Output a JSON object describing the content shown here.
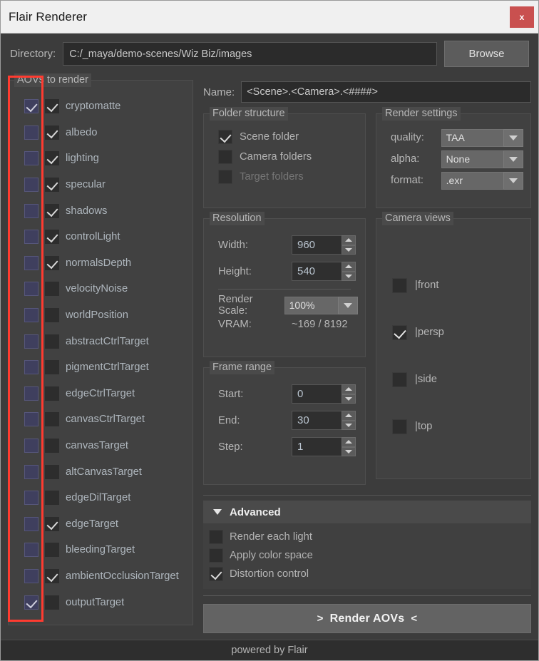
{
  "window": {
    "title": "Flair Renderer",
    "close_label": "x"
  },
  "directory": {
    "label": "Directory:",
    "value": "C:/_maya/demo-scenes/Wiz Biz/images",
    "browse_label": "Browse"
  },
  "aovs": {
    "group_title": "AOVs to render",
    "items": [
      {
        "label": "cryptomatte",
        "col1": true,
        "col2": true
      },
      {
        "label": "albedo",
        "col1": false,
        "col2": true
      },
      {
        "label": "lighting",
        "col1": false,
        "col2": true
      },
      {
        "label": "specular",
        "col1": false,
        "col2": true
      },
      {
        "label": "shadows",
        "col1": false,
        "col2": true
      },
      {
        "label": "controlLight",
        "col1": false,
        "col2": true
      },
      {
        "label": "normalsDepth",
        "col1": false,
        "col2": true
      },
      {
        "label": "velocityNoise",
        "col1": false,
        "col2": false
      },
      {
        "label": "worldPosition",
        "col1": false,
        "col2": false
      },
      {
        "label": "abstractCtrlTarget",
        "col1": false,
        "col2": false
      },
      {
        "label": "pigmentCtrlTarget",
        "col1": false,
        "col2": false
      },
      {
        "label": "edgeCtrlTarget",
        "col1": false,
        "col2": false
      },
      {
        "label": "canvasCtrlTarget",
        "col1": false,
        "col2": false
      },
      {
        "label": "canvasTarget",
        "col1": false,
        "col2": false
      },
      {
        "label": "altCanvasTarget",
        "col1": false,
        "col2": false
      },
      {
        "label": "edgeDilTarget",
        "col1": false,
        "col2": false
      },
      {
        "label": "edgeTarget",
        "col1": false,
        "col2": true
      },
      {
        "label": "bleedingTarget",
        "col1": false,
        "col2": false
      },
      {
        "label": "ambientOcclusionTarget",
        "col1": false,
        "col2": true
      },
      {
        "label": "outputTarget",
        "col1": true,
        "col2": false
      }
    ]
  },
  "name_field": {
    "label": "Name:",
    "value": "<Scene>.<Camera>.<####>"
  },
  "folder_structure": {
    "title": "Folder structure",
    "items": [
      {
        "label": "Scene folder",
        "checked": true,
        "disabled": false
      },
      {
        "label": "Camera folders",
        "checked": false,
        "disabled": false
      },
      {
        "label": "Target folders",
        "checked": false,
        "disabled": true
      }
    ]
  },
  "render_settings": {
    "title": "Render settings",
    "rows": [
      {
        "label": "quality:",
        "value": "TAA"
      },
      {
        "label": "alpha:",
        "value": "None"
      },
      {
        "label": "format:",
        "value": ".exr"
      }
    ]
  },
  "resolution": {
    "title": "Resolution",
    "width_label": "Width:",
    "width_value": "960",
    "height_label": "Height:",
    "height_value": "540",
    "scale_label": "Render Scale:",
    "scale_value": "100%",
    "vram_label": "VRAM:",
    "vram_value": "~169 / 8192"
  },
  "camera_views": {
    "title": "Camera views",
    "items": [
      {
        "label": "|front",
        "checked": false
      },
      {
        "label": "|persp",
        "checked": true
      },
      {
        "label": "|side",
        "checked": false
      },
      {
        "label": "|top",
        "checked": false
      }
    ]
  },
  "frame_range": {
    "title": "Frame range",
    "start_label": "Start:",
    "start_value": "0",
    "end_label": "End:",
    "end_value": "30",
    "step_label": "Step:",
    "step_value": "1"
  },
  "advanced": {
    "title": "Advanced",
    "items": [
      {
        "label": "Render each light",
        "checked": false
      },
      {
        "label": "Apply color space",
        "checked": false
      },
      {
        "label": "Distortion control",
        "checked": true
      }
    ]
  },
  "render_button": {
    "left_arrow": ">",
    "label": "Render AOVs",
    "right_arrow": "<"
  },
  "footer": {
    "text": "powered by Flair"
  },
  "colors": {
    "accent_red": "#ff3b30",
    "close_red": "#c9504f",
    "panel_bg": "#414141",
    "window_bg": "#3c3c3c",
    "violet_checkbox": "#3f3f5e"
  }
}
